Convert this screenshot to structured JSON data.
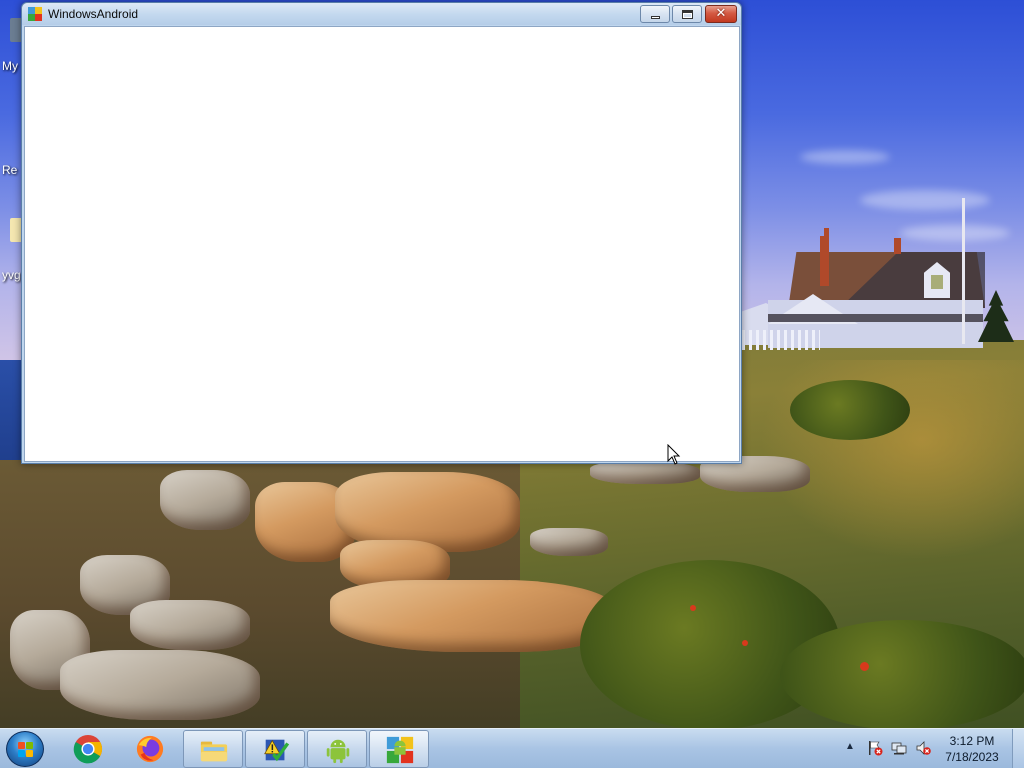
{
  "window": {
    "title": "WindowsAndroid",
    "minimize_icon": "minimize-icon",
    "maximize_icon": "restore-icon",
    "close_icon": "close-icon"
  },
  "desktop": {
    "icons": [
      {
        "label": "My",
        "icon": "computer-icon"
      },
      {
        "label": "Re",
        "icon": "recycle-bin-icon"
      },
      {
        "label": "yvg",
        "icon": "file-icon"
      }
    ]
  },
  "taskbar": {
    "start_icon": "windows-start-icon",
    "pinned": [
      {
        "name": "chrome",
        "icon": "chrome-icon"
      },
      {
        "name": "firefox",
        "icon": "firefox-icon"
      },
      {
        "name": "file-explorer",
        "icon": "folder-icon"
      },
      {
        "name": "task-app",
        "icon": "checklist-icon"
      },
      {
        "name": "android",
        "icon": "android-icon"
      },
      {
        "name": "windowsandroid",
        "icon": "windowsandroid-icon"
      }
    ]
  },
  "tray": {
    "time": "3:12 PM",
    "date": "7/18/2023",
    "icons": [
      "show-hidden-icons-arrow",
      "action-center-flag-icon",
      "network-icon",
      "volume-muted-icon"
    ]
  },
  "colors": {
    "window_frame": "#bfd6ee",
    "close_button": "#c2381f",
    "taskbar": "#a9c4e4"
  }
}
